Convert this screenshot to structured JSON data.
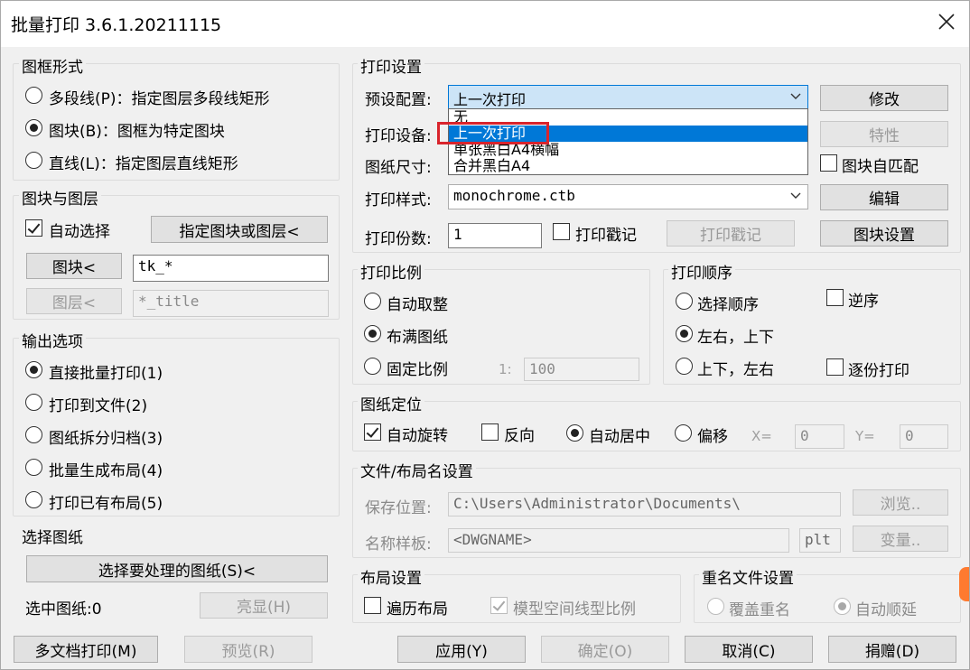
{
  "window": {
    "title": "批量打印 3.6.1.20211115",
    "close_icon": "close-icon"
  },
  "frame_form": {
    "title": "图框形式",
    "options": [
      {
        "label": "多段线(P)：指定图层多段线矩形",
        "checked": false
      },
      {
        "label": "图块(B)：图框为特定图块",
        "checked": true
      },
      {
        "label": "直线(L)：指定图层直线矩形",
        "checked": false
      }
    ]
  },
  "block_layer": {
    "title": "图块与图层",
    "auto_select_label": "自动选择",
    "pick_button": "指定图块或图层<",
    "block_button": "图块<",
    "block_value": "tk_*",
    "layer_button": "图层<",
    "layer_value": "*_title"
  },
  "output": {
    "title": "输出选项",
    "options": [
      {
        "label": "直接批量打印(1)",
        "checked": true
      },
      {
        "label": "打印到文件(2)",
        "checked": false
      },
      {
        "label": "图纸拆分归档(3)",
        "checked": false
      },
      {
        "label": "批量生成布局(4)",
        "checked": false
      },
      {
        "label": "打印已有布局(5)",
        "checked": false
      }
    ]
  },
  "select_sheets": {
    "title": "选择图纸",
    "select_button": "选择要处理的图纸(S)<",
    "selected_label": "选中图纸:0",
    "highlight_button": "亮显(H)"
  },
  "print_settings": {
    "title": "打印设置",
    "preset_label": "预设配置:",
    "preset_value": "上一次打印",
    "preset_options": [
      "无",
      "上一次打印",
      "单张黑白A4横幅",
      "合并黑白A4"
    ],
    "modify_button": "修改",
    "device_label": "打印设备:",
    "properties_button": "特性",
    "paper_label": "图纸尺寸:",
    "block_fit_label": "图块自匹配",
    "style_label": "打印样式:",
    "style_value": "monochrome.ctb",
    "edit_button": "编辑",
    "copies_label": "打印份数:",
    "copies_value": "1",
    "stamp_check_label": "打印戳记",
    "stamp_button": "打印戳记",
    "block_settings_button": "图块设置"
  },
  "print_scale": {
    "title": "打印比例",
    "auto_round": "自动取整",
    "fit_paper": "布满图纸",
    "fixed_scale": "固定比例",
    "ratio_prefix": "1:",
    "ratio_value": "100",
    "selected": "fit_paper"
  },
  "print_order": {
    "title": "打印顺序",
    "select_order": "选择顺序",
    "reverse": "逆序",
    "lr_tb": "左右，上下",
    "tb_lr": "上下，左右",
    "collate": "逐份打印",
    "selected": "lr_tb"
  },
  "paper_position": {
    "title": "图纸定位",
    "auto_rotate": "自动旋转",
    "reverse": "反向",
    "auto_center": "自动居中",
    "offset": "偏移",
    "x_label": "X=",
    "x_value": "0",
    "y_label": "Y=",
    "y_value": "0"
  },
  "file_layout": {
    "title": "文件/布局名设置",
    "save_label": "保存位置:",
    "save_value": "C:\\Users\\Administrator\\Documents\\",
    "browse_button": "浏览..",
    "name_label": "名称样板:",
    "name_value": "<DWGNAME>",
    "ext_value": "plt",
    "variable_button": "变量.."
  },
  "layout_settings": {
    "title": "布局设置",
    "traverse": "遍历布局",
    "model_scale": "模型空间线型比例"
  },
  "rename": {
    "title": "重名文件设置",
    "overwrite": "覆盖重名",
    "auto_extend": "自动顺延"
  },
  "footer": {
    "multi_doc": "多文档打印(M)",
    "preview": "预览(R)",
    "apply": "应用(Y)",
    "ok": "确定(O)",
    "cancel": "取消(C)",
    "donate": "捐赠(D)"
  }
}
